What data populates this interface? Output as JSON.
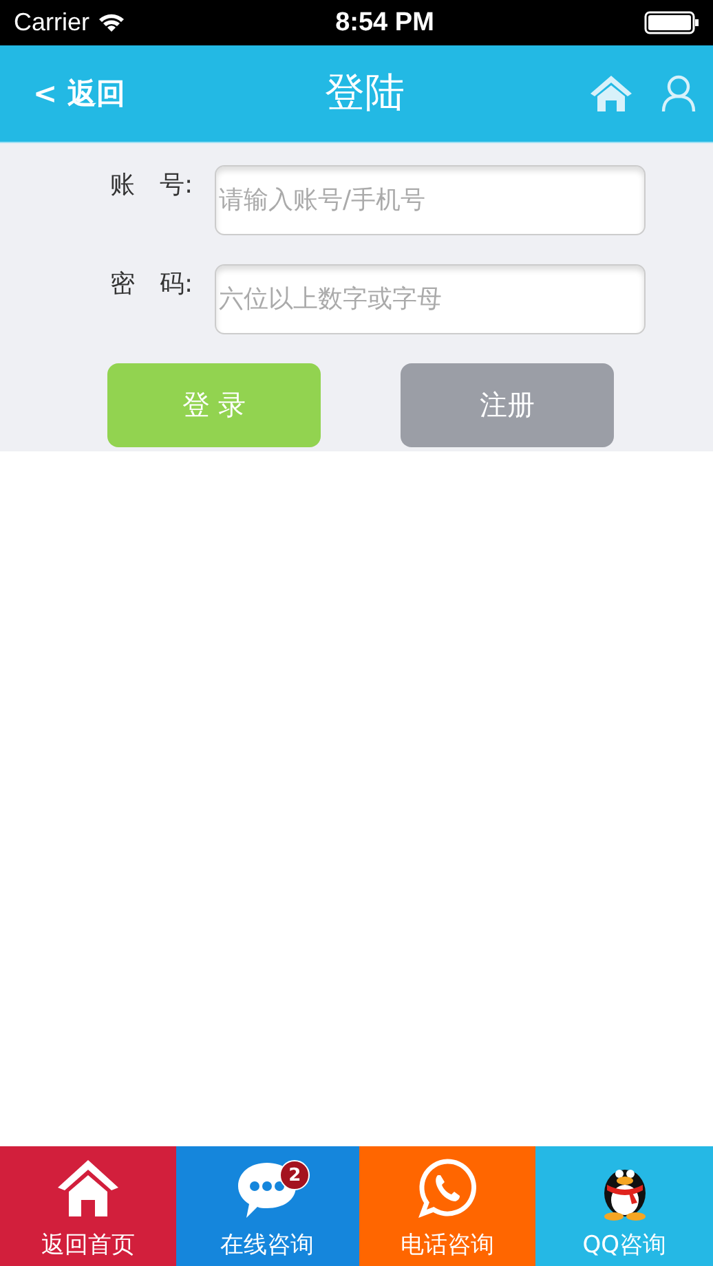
{
  "status_bar": {
    "carrier": "Carrier",
    "time": "8:54 PM"
  },
  "nav_bar": {
    "back": "< 返回",
    "title": "登陆"
  },
  "form": {
    "fields": [
      {
        "label": "账　号:",
        "placeholder": "请输入账号/手机号"
      },
      {
        "label": "密　码:",
        "placeholder": "六位以上数字或字母"
      }
    ],
    "buttons": [
      {
        "label": "登 录",
        "color": "#92d350"
      },
      {
        "label": "注册",
        "color": "#9b9ea6"
      }
    ]
  },
  "tab_bar": [
    {
      "label": "返回首页",
      "kind": "home",
      "color": "#d21f3c"
    },
    {
      "label": "在线咨询",
      "kind": "chat",
      "color": "#1586dc",
      "badge": "2"
    },
    {
      "label": "电话咨询",
      "kind": "phone",
      "color": "#ff6600"
    },
    {
      "label": "QQ咨询",
      "kind": "qq",
      "color": "#25b8e5"
    }
  ]
}
